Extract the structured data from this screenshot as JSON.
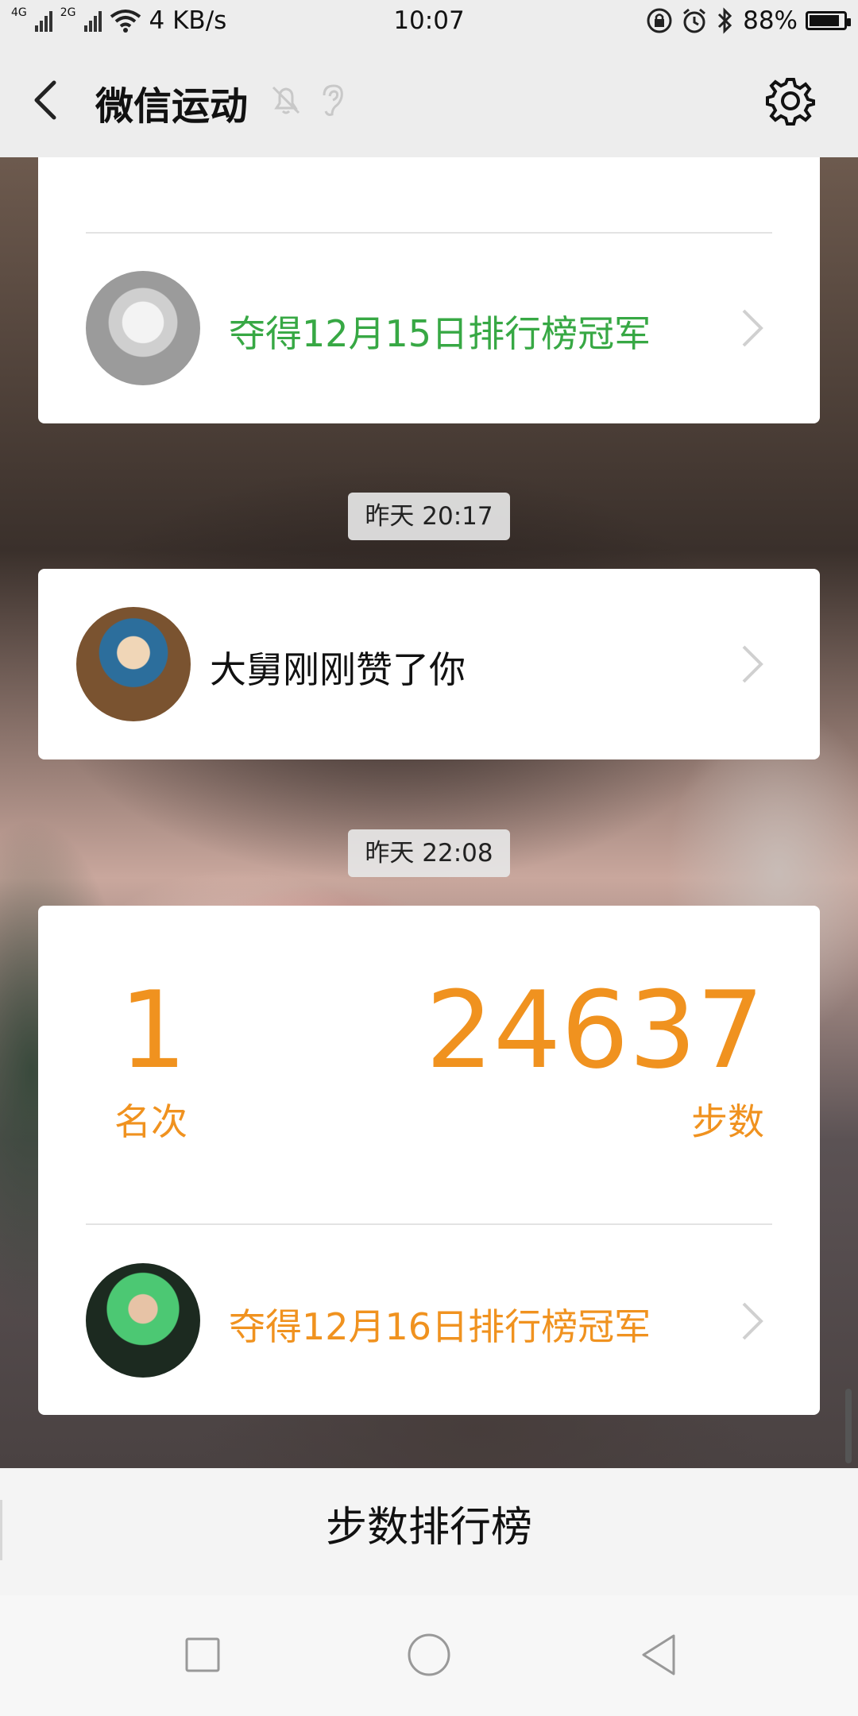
{
  "status_bar": {
    "network_1": "4G",
    "network_2": "2G",
    "speed": "4 KB/s",
    "time": "10:07",
    "battery": "88%",
    "battery_level": 0.88
  },
  "header": {
    "title": "微信运动"
  },
  "messages": [
    {
      "type": "champion",
      "text": "夺得12月15日排行榜冠军",
      "color": "#37a844",
      "avatar": "samoyed-avatar"
    },
    {
      "time": "昨天 20:17",
      "type": "like",
      "text": "大舅刚刚赞了你",
      "avatar": "monk-avatar"
    },
    {
      "time": "昨天 22:08",
      "type": "rank",
      "rank_value": "1",
      "rank_label": "名次",
      "steps_value": "24637",
      "steps_label": "步数",
      "text": "夺得12月16日排行榜冠军",
      "color": "#f0921f",
      "avatar": "girl-avatar"
    }
  ],
  "bottom": {
    "rank_tab_label": "步数排行榜"
  }
}
